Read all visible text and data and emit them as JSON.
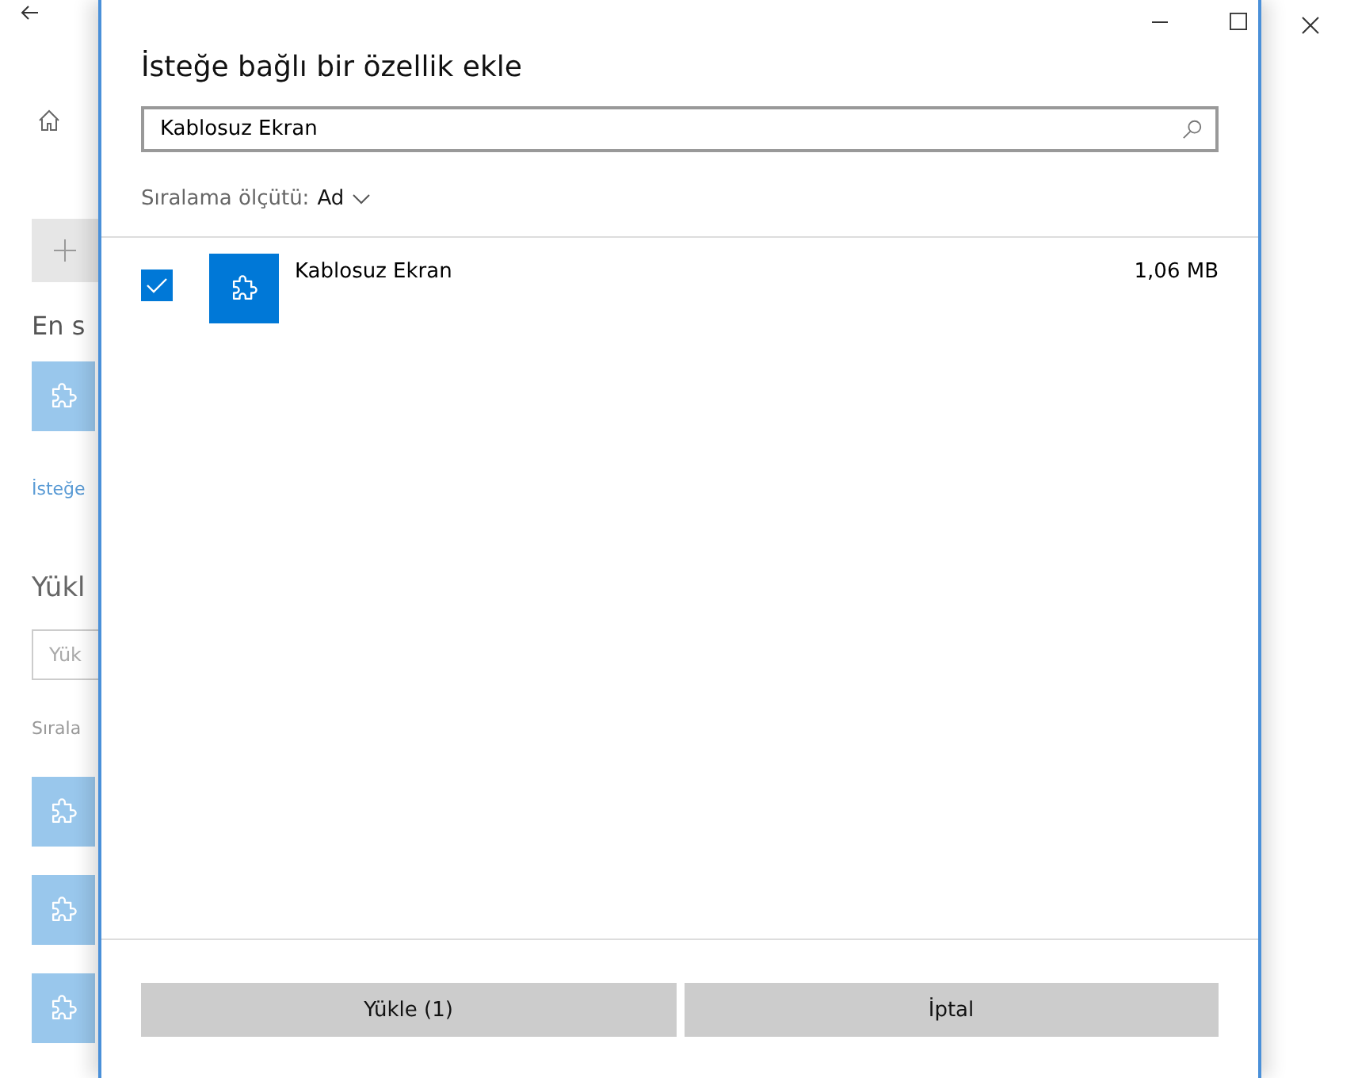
{
  "background": {
    "recent_heading": "En s",
    "link": "İsteğe",
    "installed_heading": "Yükl",
    "search": {
      "placeholder": "Yük"
    },
    "sort_label": "Sırala"
  },
  "dialog": {
    "title": "İsteğe bağlı bir özellik ekle",
    "search": {
      "value": "Kablosuz Ekran"
    },
    "sort": {
      "label": "Sıralama ölçütü:",
      "value": "Ad"
    },
    "features": [
      {
        "name": "Kablosuz Ekran",
        "size": "1,06 MB",
        "checked": true
      }
    ],
    "buttons": [
      "Yükle (1)",
      "İptal"
    ]
  }
}
